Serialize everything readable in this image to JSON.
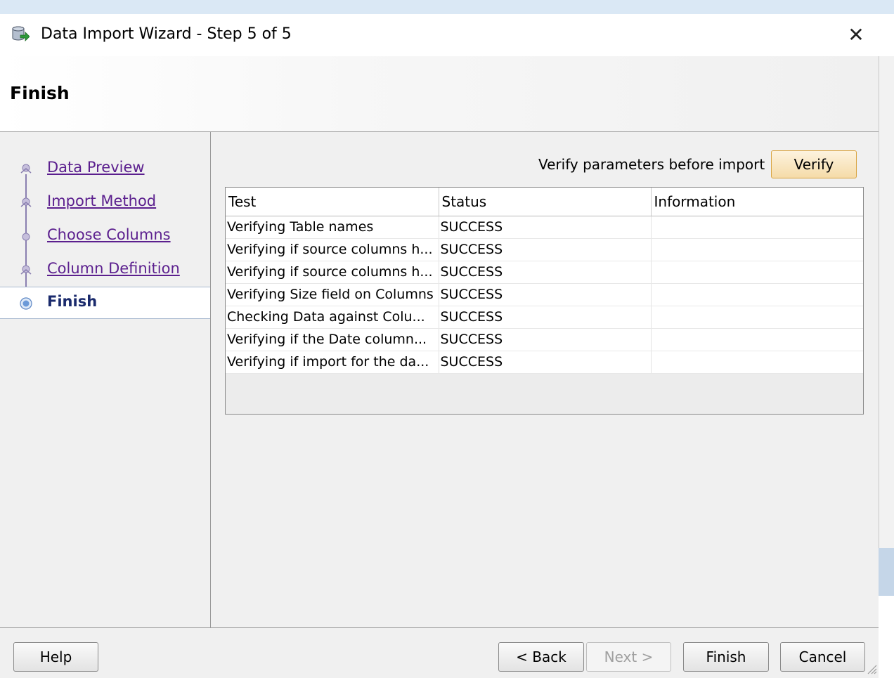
{
  "window": {
    "title": "Data Import Wizard - Step 5 of 5",
    "close_glyph": "✕"
  },
  "header": {
    "title": "Finish"
  },
  "nav": {
    "items": [
      {
        "label": "Data Preview",
        "state": "visited"
      },
      {
        "label": "Import Method",
        "state": "visited"
      },
      {
        "label": "Choose Columns",
        "state": "visited"
      },
      {
        "label": "Column Definition",
        "state": "visited"
      },
      {
        "label": "Finish",
        "state": "current"
      }
    ]
  },
  "verify": {
    "label": "Verify parameters before import",
    "button": "Verify"
  },
  "results": {
    "columns": [
      "Test",
      "Status",
      "Information"
    ],
    "rows": [
      [
        "Verifying Table names",
        "SUCCESS",
        ""
      ],
      [
        "Verifying if source columns h...",
        "SUCCESS",
        ""
      ],
      [
        "Verifying if source columns h...",
        "SUCCESS",
        ""
      ],
      [
        "Verifying Size field on Columns",
        "SUCCESS",
        ""
      ],
      [
        "Checking Data against Colu...",
        "SUCCESS",
        ""
      ],
      [
        "Verifying if the Date column...",
        "SUCCESS",
        ""
      ],
      [
        "Verifying if import for the da...",
        "SUCCESS",
        ""
      ]
    ]
  },
  "footer": {
    "help": "Help",
    "back": "< Back",
    "next": "Next >",
    "finish": "Finish",
    "cancel": "Cancel"
  },
  "colors": {
    "visited_link": "#5b1f8e",
    "current_step": "#1a2a6c",
    "verify_button": "#f5dba8"
  },
  "icons": {
    "title": "database-import-icon",
    "close": "close-icon",
    "resize": "resize-grip-icon"
  }
}
